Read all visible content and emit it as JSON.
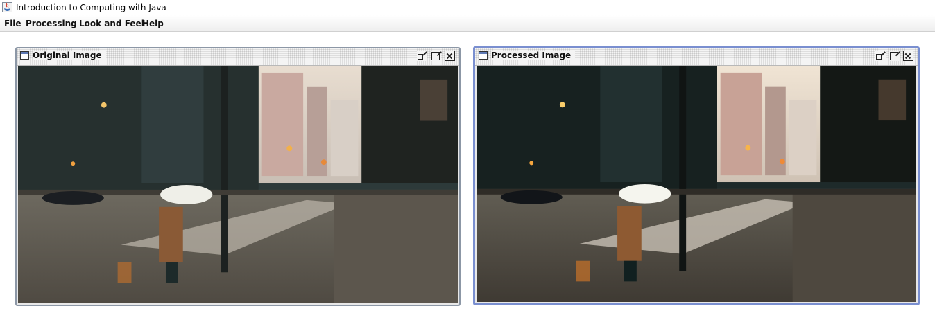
{
  "window": {
    "title": "Introduction to Computing with Java"
  },
  "menu": {
    "items": [
      "File",
      "Processing",
      "Look and Feel",
      "Help"
    ]
  },
  "frames": [
    {
      "title": "Original Image"
    },
    {
      "title": "Processed Image"
    }
  ]
}
